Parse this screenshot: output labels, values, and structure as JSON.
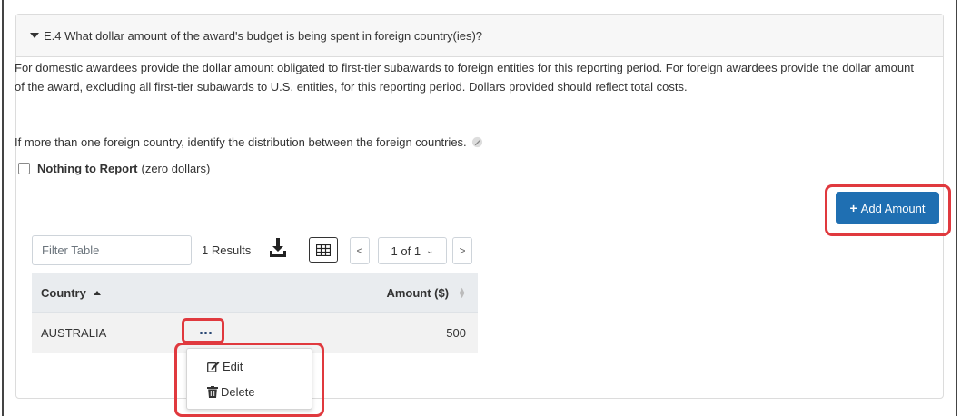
{
  "section": {
    "header": "E.4 What dollar amount of the award's budget is being spent in foreign country(ies)?",
    "description": "For domestic awardees provide the dollar amount obligated to first-tier subawards to foreign entities for this reporting period. For foreign awardees provide the dollar amount of the award, excluding all first-tier subawards to U.S. entities, for this reporting period. Dollars provided should reflect total costs.",
    "distribution_note": "If more than one foreign country, identify the distribution between the foreign countries.",
    "nothing_to_report_label": "Nothing to Report",
    "nothing_to_report_hint": "(zero dollars)",
    "nothing_to_report_checked": false
  },
  "add_button_label": "Add Amount",
  "toolbar": {
    "filter_placeholder": "Filter Table",
    "results": "1 Results",
    "page_indicator": "1 of 1",
    "prev": "<",
    "next": ">"
  },
  "table": {
    "columns": [
      "Country",
      "Amount ($)"
    ],
    "rows": [
      {
        "country": "AUSTRALIA",
        "amount": "500"
      }
    ]
  },
  "row_menu": {
    "items": [
      "Edit",
      "Delete"
    ]
  },
  "colors": {
    "primary": "#1f6fb2",
    "highlight": "#e0393e"
  }
}
